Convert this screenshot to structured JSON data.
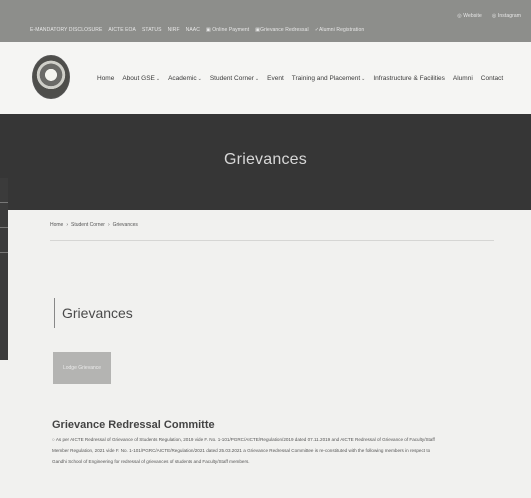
{
  "topbar": {
    "links": [
      "E-MANDATORY DISCLOSURE",
      "AICTE EOA",
      "STATUS",
      "NIRF",
      "NAAC",
      "Online Payment",
      "Grievance Redressal",
      "Alumni Registration"
    ],
    "right": [
      "Website",
      "Instagram"
    ]
  },
  "nav": {
    "items": [
      {
        "label": "Home",
        "has_dropdown": false
      },
      {
        "label": "About GSE",
        "has_dropdown": true
      },
      {
        "label": "Academic",
        "has_dropdown": true
      },
      {
        "label": "Student Corner",
        "has_dropdown": true
      },
      {
        "label": "Event",
        "has_dropdown": false
      },
      {
        "label": "Training and Placement",
        "has_dropdown": true
      },
      {
        "label": "Infrastructure & Facilities",
        "has_dropdown": false
      },
      {
        "label": "Alumni",
        "has_dropdown": false
      },
      {
        "label": "Contact",
        "has_dropdown": false
      }
    ]
  },
  "banner": {
    "title": "Grievances"
  },
  "breadcrumb": {
    "home": "Home",
    "parent": "Student Corner",
    "current": "Grievances",
    "separator": "›"
  },
  "section": {
    "title": "Grievances"
  },
  "button": {
    "label": "Lodge Grievance"
  },
  "committee": {
    "heading": "Grievance Redressal Committe",
    "lines": [
      "As per AICTE Redressal of Grievance of Students Regulation, 2019 vide F. No. 1-101/PGRC/AICTE/Regulation/2019 dated 07.11.2019 and AICTE Redressal of Grievance of Faculty/Staff",
      "Member Regulation, 2021 vide F. No. 1-101/PGRC/AICTE/Regulation/2021 dated 25.03.2021 a Grievance Redressal Committee is re-constituted with the following members in respect to",
      "Gandhi School of Engineering  for redressal of grievances of students and Faculty/Staff members."
    ]
  },
  "colors": {
    "banner_bg": "#363636",
    "topbar_bg": "#8d8e8b",
    "button_bg": "#b4b4b2"
  }
}
